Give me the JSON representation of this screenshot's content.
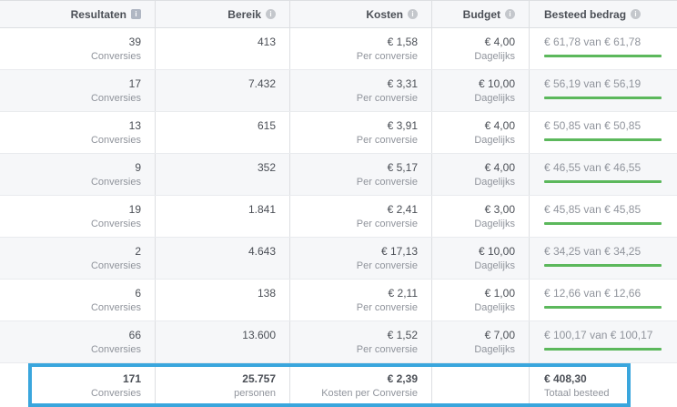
{
  "header": {
    "results": "Resultaten",
    "reach": "Bereik",
    "cost": "Kosten",
    "budget": "Budget",
    "spent": "Besteed bedrag"
  },
  "rows": [
    {
      "results": "39",
      "results_sub": "Conversies",
      "reach": "413",
      "cost": "€ 1,58",
      "cost_sub": "Per conversie",
      "budget": "€ 4,00",
      "budget_sub": "Dagelijks",
      "spent": "€ 61,78",
      "of": "van",
      "spent_total": "€ 61,78",
      "progress": 1.0
    },
    {
      "results": "17",
      "results_sub": "Conversies",
      "reach": "7.432",
      "cost": "€ 3,31",
      "cost_sub": "Per conversie",
      "budget": "€ 10,00",
      "budget_sub": "Dagelijks",
      "spent": "€ 56,19",
      "of": "van",
      "spent_total": "€ 56,19",
      "progress": 1.0
    },
    {
      "results": "13",
      "results_sub": "Conversies",
      "reach": "615",
      "cost": "€ 3,91",
      "cost_sub": "Per conversie",
      "budget": "€ 4,00",
      "budget_sub": "Dagelijks",
      "spent": "€ 50,85",
      "of": "van",
      "spent_total": "€ 50,85",
      "progress": 1.0
    },
    {
      "results": "9",
      "results_sub": "Conversies",
      "reach": "352",
      "cost": "€ 5,17",
      "cost_sub": "Per conversie",
      "budget": "€ 4,00",
      "budget_sub": "Dagelijks",
      "spent": "€ 46,55",
      "of": "van",
      "spent_total": "€ 46,55",
      "progress": 1.0
    },
    {
      "results": "19",
      "results_sub": "Conversies",
      "reach": "1.841",
      "cost": "€ 2,41",
      "cost_sub": "Per conversie",
      "budget": "€ 3,00",
      "budget_sub": "Dagelijks",
      "spent": "€ 45,85",
      "of": "van",
      "spent_total": "€ 45,85",
      "progress": 1.0
    },
    {
      "results": "2",
      "results_sub": "Conversies",
      "reach": "4.643",
      "cost": "€ 17,13",
      "cost_sub": "Per conversie",
      "budget": "€ 10,00",
      "budget_sub": "Dagelijks",
      "spent": "€ 34,25",
      "of": "van",
      "spent_total": "€ 34,25",
      "progress": 1.0
    },
    {
      "results": "6",
      "results_sub": "Conversies",
      "reach": "138",
      "cost": "€ 2,11",
      "cost_sub": "Per conversie",
      "budget": "€ 1,00",
      "budget_sub": "Dagelijks",
      "spent": "€ 12,66",
      "of": "van",
      "spent_total": "€ 12,66",
      "progress": 1.0
    },
    {
      "results": "66",
      "results_sub": "Conversies",
      "reach": "13.600",
      "cost": "€ 1,52",
      "cost_sub": "Per conversie",
      "budget": "€ 7,00",
      "budget_sub": "Dagelijks",
      "spent": "€ 100,17",
      "of": "van",
      "spent_total": "€ 100,17",
      "progress": 1.0
    }
  ],
  "totals": {
    "results": "171",
    "results_sub": "Conversies",
    "reach": "25.757",
    "reach_sub": "personen",
    "cost": "€ 2,39",
    "cost_sub": "Kosten per Conversie",
    "spent": "€ 408,30",
    "spent_sub": "Totaal besteed"
  },
  "colors": {
    "progress_bar": "#5cb85c",
    "highlight_border": "#3aa6dd",
    "info_icon": "#c4c7cc"
  },
  "icons": {
    "results_header": "info-square-icon",
    "other_headers": "info-circle-icon"
  }
}
